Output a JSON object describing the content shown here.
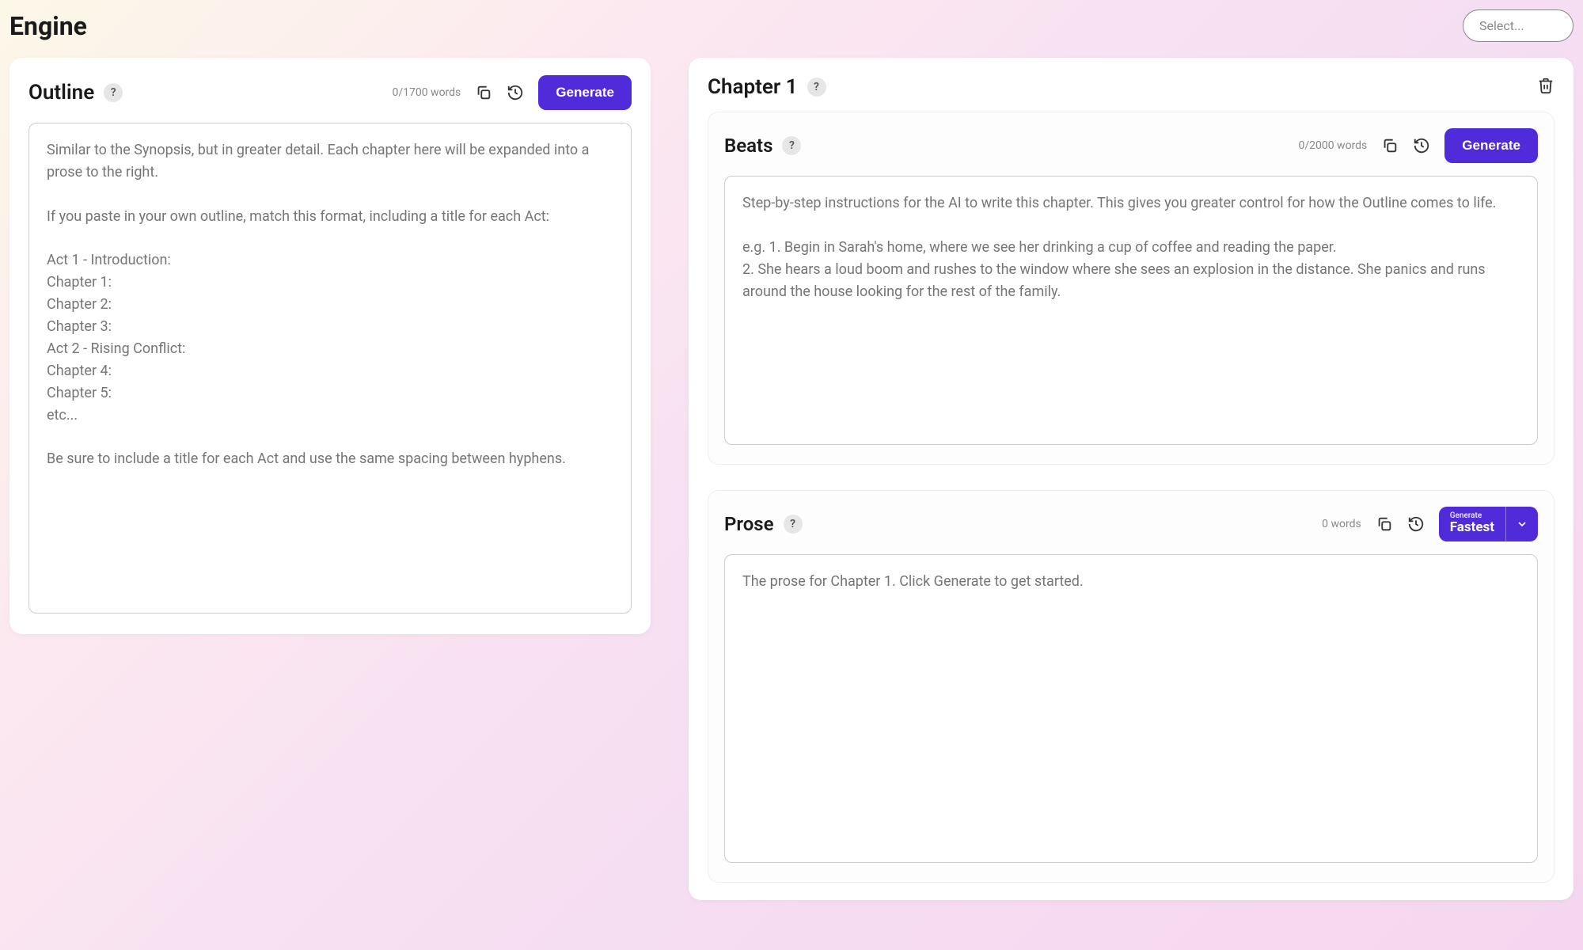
{
  "header": {
    "title": "Engine",
    "select_placeholder": "Select..."
  },
  "outline": {
    "title": "Outline",
    "help": "?",
    "word_count": "0/1700 words",
    "generate_label": "Generate",
    "placeholder": "Similar to the Synopsis, but in greater detail. Each chapter here will be expanded into a prose to the right.\n\nIf you paste in your own outline, match this format, including a title for each Act:\n\nAct 1 - Introduction:\nChapter 1:\nChapter 2:\nChapter 3:\nAct 2 - Rising Conflict:\nChapter 4:\nChapter 5:\netc...\n\nBe sure to include a title for each Act and use the same spacing between hyphens."
  },
  "chapter": {
    "title": "Chapter 1",
    "help": "?",
    "beats": {
      "title": "Beats",
      "help": "?",
      "word_count": "0/2000 words",
      "generate_label": "Generate",
      "placeholder": "Step-by-step instructions for the AI to write this chapter. This gives you greater control for how the Outline comes to life.\n\ne.g. 1. Begin in Sarah's home, where we see her drinking a cup of coffee and reading the paper.\n2. She hears a loud boom and rushes to the window where she sees an explosion in the distance. She panics and runs around the house looking for the rest of the family."
    },
    "prose": {
      "title": "Prose",
      "help": "?",
      "word_count": "0 words",
      "generate_small": "Generate",
      "generate_big": "Fastest",
      "placeholder": "The prose for Chapter 1. Click Generate to get started."
    }
  },
  "colors": {
    "accent": "#4f2bd9"
  }
}
